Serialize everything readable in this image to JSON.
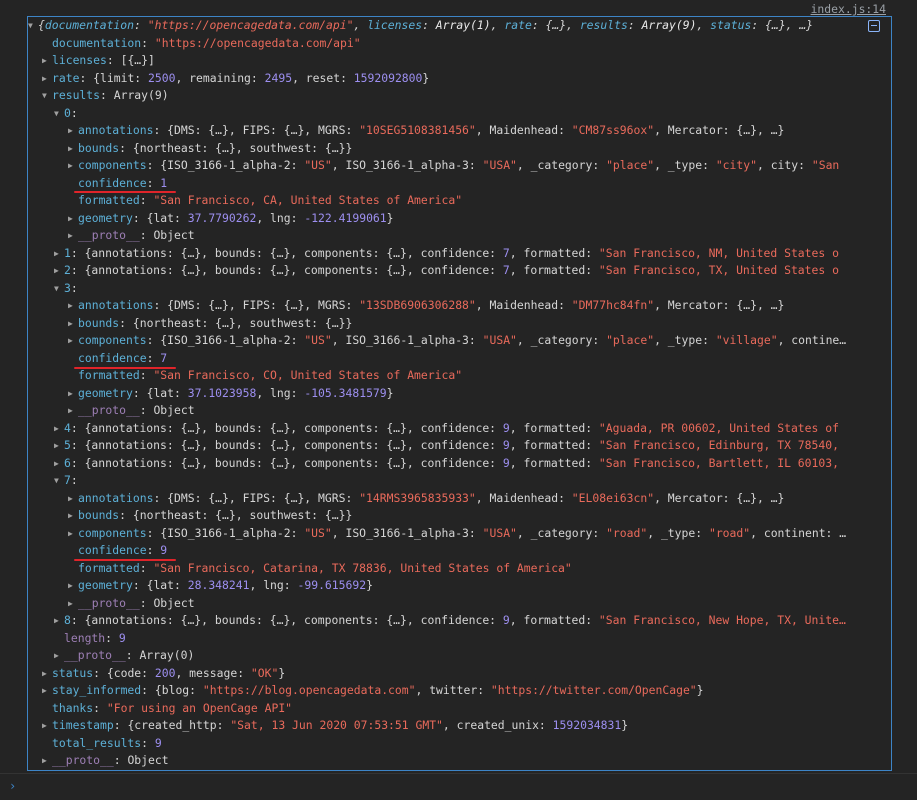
{
  "source_link": "index.js:14",
  "root_summary": {
    "p1": "{",
    "k1": "documentation",
    "p2": ": ",
    "v1": "\"https://opencagedata.com/api\"",
    "p3": ", ",
    "k2": "licenses",
    "p4": ": ",
    "v2": "Array(1)",
    "p5": ", ",
    "k3": "rate",
    "p6": ": {…}, ",
    "k4": "results",
    "p7": ": ",
    "v4": "Array(9)",
    "p8": ", ",
    "k5": "status",
    "p9": ": {…}, …}"
  },
  "lines": {
    "documentation": {
      "k": "documentation",
      "v": "\"https://opencagedata.com/api\""
    },
    "licenses": {
      "k": "licenses",
      "v": "[{…}]"
    },
    "rate": {
      "k": "rate",
      "a": "{limit: ",
      "v1": "2500",
      "b": ", remaining: ",
      "v2": "2495",
      "c": ", reset: ",
      "v3": "1592092800",
      "d": "}"
    },
    "results": {
      "k": "results",
      "v": "Array(9)"
    },
    "r0": {
      "k": "0",
      "p": ":"
    },
    "r0_ann": {
      "k": "annotations",
      "a": "{DMS: {…}, FIPS: {…}, MGRS: ",
      "v1": "\"10SEG5108381456\"",
      "b": ", Maidenhead: ",
      "v2": "\"CM87ss96ox\"",
      "c": ", Mercator: {…}, …}"
    },
    "r0_bounds": {
      "k": "bounds",
      "a": "{northeast: {…}, southwest: {…}}"
    },
    "r0_comp": {
      "k": "components",
      "a": "{ISO_3166-1_alpha-2: ",
      "v1": "\"US\"",
      "b": ", ISO_3166-1_alpha-3: ",
      "v2": "\"USA\"",
      "c": ", _category: ",
      "v3": "\"place\"",
      "d": ", _type: ",
      "v4": "\"city\"",
      "e": ", city: ",
      "v5": "\"San"
    },
    "r0_conf": {
      "k": "confidence",
      "v": "1"
    },
    "r0_fmt": {
      "k": "formatted",
      "v": "\"San Francisco, CA, United States of America\""
    },
    "r0_geo": {
      "k": "geometry",
      "a": "{lat: ",
      "v1": "37.7790262",
      "b": ", lng: ",
      "v2": "-122.4199061",
      "c": "}"
    },
    "r0_proto": {
      "k": "__proto__",
      "v": "Object"
    },
    "r1": {
      "k": "1",
      "a": "{annotations: {…}, bounds: {…}, components: {…}, confidence: ",
      "v1": "7",
      "b": ", formatted: ",
      "v2": "\"San Francisco, NM, United States o"
    },
    "r2": {
      "k": "2",
      "a": "{annotations: {…}, bounds: {…}, components: {…}, confidence: ",
      "v1": "7",
      "b": ", formatted: ",
      "v2": "\"San Francisco, TX, United States o"
    },
    "r3": {
      "k": "3",
      "p": ":"
    },
    "r3_ann": {
      "k": "annotations",
      "a": "{DMS: {…}, FIPS: {…}, MGRS: ",
      "v1": "\"13SDB6906306288\"",
      "b": ", Maidenhead: ",
      "v2": "\"DM77hc84fn\"",
      "c": ", Mercator: {…}, …}"
    },
    "r3_bounds": {
      "k": "bounds",
      "a": "{northeast: {…}, southwest: {…}}"
    },
    "r3_comp": {
      "k": "components",
      "a": "{ISO_3166-1_alpha-2: ",
      "v1": "\"US\"",
      "b": ", ISO_3166-1_alpha-3: ",
      "v2": "\"USA\"",
      "c": ", _category: ",
      "v3": "\"place\"",
      "d": ", _type: ",
      "v4": "\"village\"",
      "e": ", contine…"
    },
    "r3_conf": {
      "k": "confidence",
      "v": "7"
    },
    "r3_fmt": {
      "k": "formatted",
      "v": "\"San Francisco, CO, United States of America\""
    },
    "r3_geo": {
      "k": "geometry",
      "a": "{lat: ",
      "v1": "37.1023958",
      "b": ", lng: ",
      "v2": "-105.3481579",
      "c": "}"
    },
    "r3_proto": {
      "k": "__proto__",
      "v": "Object"
    },
    "r4": {
      "k": "4",
      "a": "{annotations: {…}, bounds: {…}, components: {…}, confidence: ",
      "v1": "9",
      "b": ", formatted: ",
      "v2": "\"Aguada, PR 00602, United States of"
    },
    "r5": {
      "k": "5",
      "a": "{annotations: {…}, bounds: {…}, components: {…}, confidence: ",
      "v1": "9",
      "b": ", formatted: ",
      "v2": "\"San Francisco, Edinburg, TX 78540,"
    },
    "r6": {
      "k": "6",
      "a": "{annotations: {…}, bounds: {…}, components: {…}, confidence: ",
      "v1": "9",
      "b": ", formatted: ",
      "v2": "\"San Francisco, Bartlett, IL 60103,"
    },
    "r7": {
      "k": "7",
      "p": ":"
    },
    "r7_ann": {
      "k": "annotations",
      "a": "{DMS: {…}, FIPS: {…}, MGRS: ",
      "v1": "\"14RMS3965835933\"",
      "b": ", Maidenhead: ",
      "v2": "\"EL08ei63cn\"",
      "c": ", Mercator: {…}, …}"
    },
    "r7_bounds": {
      "k": "bounds",
      "a": "{northeast: {…}, southwest: {…}}"
    },
    "r7_comp": {
      "k": "components",
      "a": "{ISO_3166-1_alpha-2: ",
      "v1": "\"US\"",
      "b": ", ISO_3166-1_alpha-3: ",
      "v2": "\"USA\"",
      "c": ", _category: ",
      "v3": "\"road\"",
      "d": ", _type: ",
      "v4": "\"road\"",
      "e": ", continent: …"
    },
    "r7_conf": {
      "k": "confidence",
      "v": "9"
    },
    "r7_fmt": {
      "k": "formatted",
      "v": "\"San Francisco, Catarina, TX 78836, United States of America\""
    },
    "r7_geo": {
      "k": "geometry",
      "a": "{lat: ",
      "v1": "28.348241",
      "b": ", lng: ",
      "v2": "-99.615692",
      "c": "}"
    },
    "r7_proto": {
      "k": "__proto__",
      "v": "Object"
    },
    "r8": {
      "k": "8",
      "a": "{annotations: {…}, bounds: {…}, components: {…}, confidence: ",
      "v1": "9",
      "b": ", formatted: ",
      "v2": "\"San Francisco, New Hope, TX, Unite…"
    },
    "length": {
      "k": "length",
      "v": "9"
    },
    "res_proto": {
      "k": "__proto__",
      "v": "Array(0)"
    },
    "status": {
      "k": "status",
      "a": "{code: ",
      "v1": "200",
      "b": ", message: ",
      "v2": "\"OK\"",
      "c": "}"
    },
    "stay": {
      "k": "stay_informed",
      "a": "{blog: ",
      "v1": "\"https://blog.opencagedata.com\"",
      "b": ", twitter: ",
      "v2": "\"https://twitter.com/OpenCage\"",
      "c": "}"
    },
    "thanks": {
      "k": "thanks",
      "v": "\"For using an OpenCage API\""
    },
    "timestamp": {
      "k": "timestamp",
      "a": "{created_http: ",
      "v1": "\"Sat, 13 Jun 2020 07:53:51 GMT\"",
      "b": ", created_unix: ",
      "v2": "1592034831",
      "c": "}"
    },
    "total": {
      "k": "total_results",
      "v": "9"
    },
    "root_proto": {
      "k": "__proto__",
      "v": "Object"
    }
  },
  "icons": {
    "expanded": "▼",
    "collapsed": "▶",
    "prompt": "›"
  },
  "colors": {
    "key": "#5db0d7",
    "string": "#e96a5b",
    "number": "#9d8ff0",
    "highlight_border": "#3d84c6",
    "annotation": "#e0242a"
  }
}
